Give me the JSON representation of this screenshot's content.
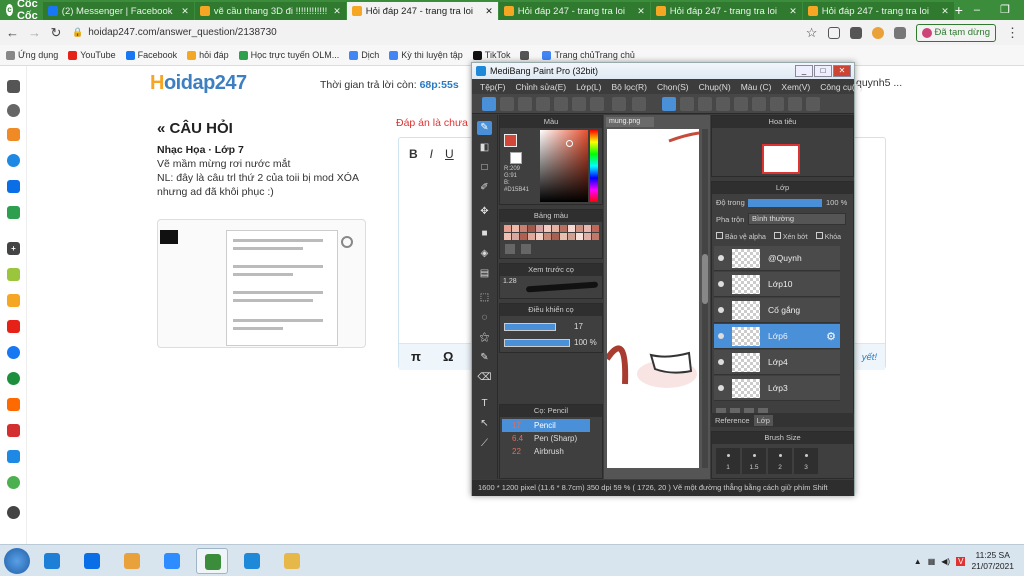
{
  "browser": {
    "brand": "Cốc Cốc",
    "tabs": [
      {
        "title": "(2) Messenger | Facebook",
        "color": "#1877f2",
        "active": false
      },
      {
        "title": "vẽ cầu thang 3D đi !!!!!!!!!!!!",
        "color": "#f5a623",
        "active": false
      },
      {
        "title": "Hỏi đáp 247 - trang tra loi",
        "color": "#f5a623",
        "active": true
      },
      {
        "title": "Hỏi đáp 247 - trang tra loi",
        "color": "#f5a623",
        "active": false
      },
      {
        "title": "Hỏi đáp 247 - trang tra loi",
        "color": "#f5a623",
        "active": false
      },
      {
        "title": "Hỏi đáp 247 - trang tra loi",
        "color": "#f5a623",
        "active": false
      }
    ],
    "new_tab": "+",
    "url": "hoidap247.com/answer_question/2138730",
    "paused_label": "Đã tạm dừng",
    "bookmarks": [
      {
        "label": "Ứng dụng",
        "color": "#888"
      },
      {
        "label": "YouTube",
        "color": "#e62117"
      },
      {
        "label": "Facebook",
        "color": "#1877f2"
      },
      {
        "label": "hỏi đáp",
        "color": "#f5a623"
      },
      {
        "label": "Học trực tuyến OLM...",
        "color": "#2e9e4f"
      },
      {
        "label": "Dịch",
        "color": "#4285f4"
      },
      {
        "label": "Kỳ thi luyện tập",
        "color": "#4285f4"
      },
      {
        "label": "TikTok",
        "color": "#111"
      },
      {
        "label": "",
        "color": "#555"
      },
      {
        "label": "Trang chủTrang chủ",
        "color": "#4285f4"
      }
    ]
  },
  "page": {
    "logo_h": "H",
    "logo_rest": "oidap247",
    "timer_label": "Thời gian trả lời còn:",
    "timer_value": "68p:55s",
    "user_snip": "quynh5 ...",
    "question_title": "« CÂU HỎI",
    "question_meta": "Nhạc Họa · Lớp 7",
    "question_body": [
      "Vẽ mầm mừng rơi nước mắt",
      "NL: đây là câu trl thứ 2 của toii bị mod XÓA nhưng ad đã khôi phục :)"
    ],
    "answer_hint": "Đáp án là chưa đ",
    "editor_tools": [
      "B",
      "I",
      "U"
    ],
    "editor_pi": "π",
    "editor_omega": "Ω",
    "editor_link": "yết!"
  },
  "medibang": {
    "title": "MediBang Paint Pro (32bit)",
    "menu": [
      "Tệp(F)",
      "Chỉnh sửa(E)",
      "Lớp(L)",
      "Bộ lọc(R)",
      "Chọn(S)",
      "Chụp(N)",
      "Màu (C)",
      "Xem(V)",
      "Công cụ(T)"
    ],
    "color_panel": {
      "title": "Màu",
      "r": "R:209",
      "g": "G:91",
      "b": "B:",
      "hex": "#D15B41",
      "main": "#d1473a"
    },
    "palette_title": "Bảng màu",
    "brush_preview_title": "Xem trước cọ",
    "brush_preview_size": "1.28",
    "brush_control_title": "Điều khiển cọ",
    "brush_size_value": "17",
    "brush_opacity_value": "100 %",
    "brush_list_title": "Cọ: Pencil",
    "brushes": [
      {
        "size": "17",
        "name": "Pencil",
        "selected": true
      },
      {
        "size": "6.4",
        "name": "Pen (Sharp)",
        "selected": false
      },
      {
        "size": "22",
        "name": "Airbrush",
        "selected": false
      }
    ],
    "canvas_tab": "mung.png",
    "navigator_title": "Hoa tiêu",
    "layer_title": "Lớp",
    "opacity_label": "Độ trong",
    "opacity_value": "100 %",
    "blend_label": "Pha trộn",
    "blend_value": "Bình thường",
    "checks": [
      "Bảo vệ alpha",
      "Xén bớt",
      "Khóa"
    ],
    "layers": [
      {
        "name": "@Quynh",
        "selected": false
      },
      {
        "name": "Lớp10",
        "selected": false
      },
      {
        "name": "Cố gắng",
        "selected": false
      },
      {
        "name": "Lớp6",
        "selected": true
      },
      {
        "name": "Lớp4",
        "selected": false
      },
      {
        "name": "Lớp3",
        "selected": false
      }
    ],
    "ref_tab": "Reference",
    "layer_tab": "Lớp",
    "brush_size_panel": "Brush Size",
    "brush_size_steps": [
      "1",
      "1.5",
      "2",
      "3"
    ],
    "status": "1600 * 1200 pixel    (11.6 * 8.7cm)  350 dpi   59 %   ( 1726, 20 )   Vẽ một đường thẳng bằng cách giữ phím Shift"
  },
  "taskbar": {
    "apps": [
      {
        "name": "ie",
        "color": "#1e7fd6"
      },
      {
        "name": "zalo",
        "color": "#0a6fe6"
      },
      {
        "name": "paint",
        "color": "#e9a23b"
      },
      {
        "name": "zoom",
        "color": "#2d8cff"
      },
      {
        "name": "coccoc",
        "color": "#3b8d3b"
      },
      {
        "name": "medibang",
        "color": "#1e88d9"
      },
      {
        "name": "explorer",
        "color": "#e6b84a"
      }
    ],
    "time": "11:25 SA",
    "date": "21/07/2021"
  }
}
